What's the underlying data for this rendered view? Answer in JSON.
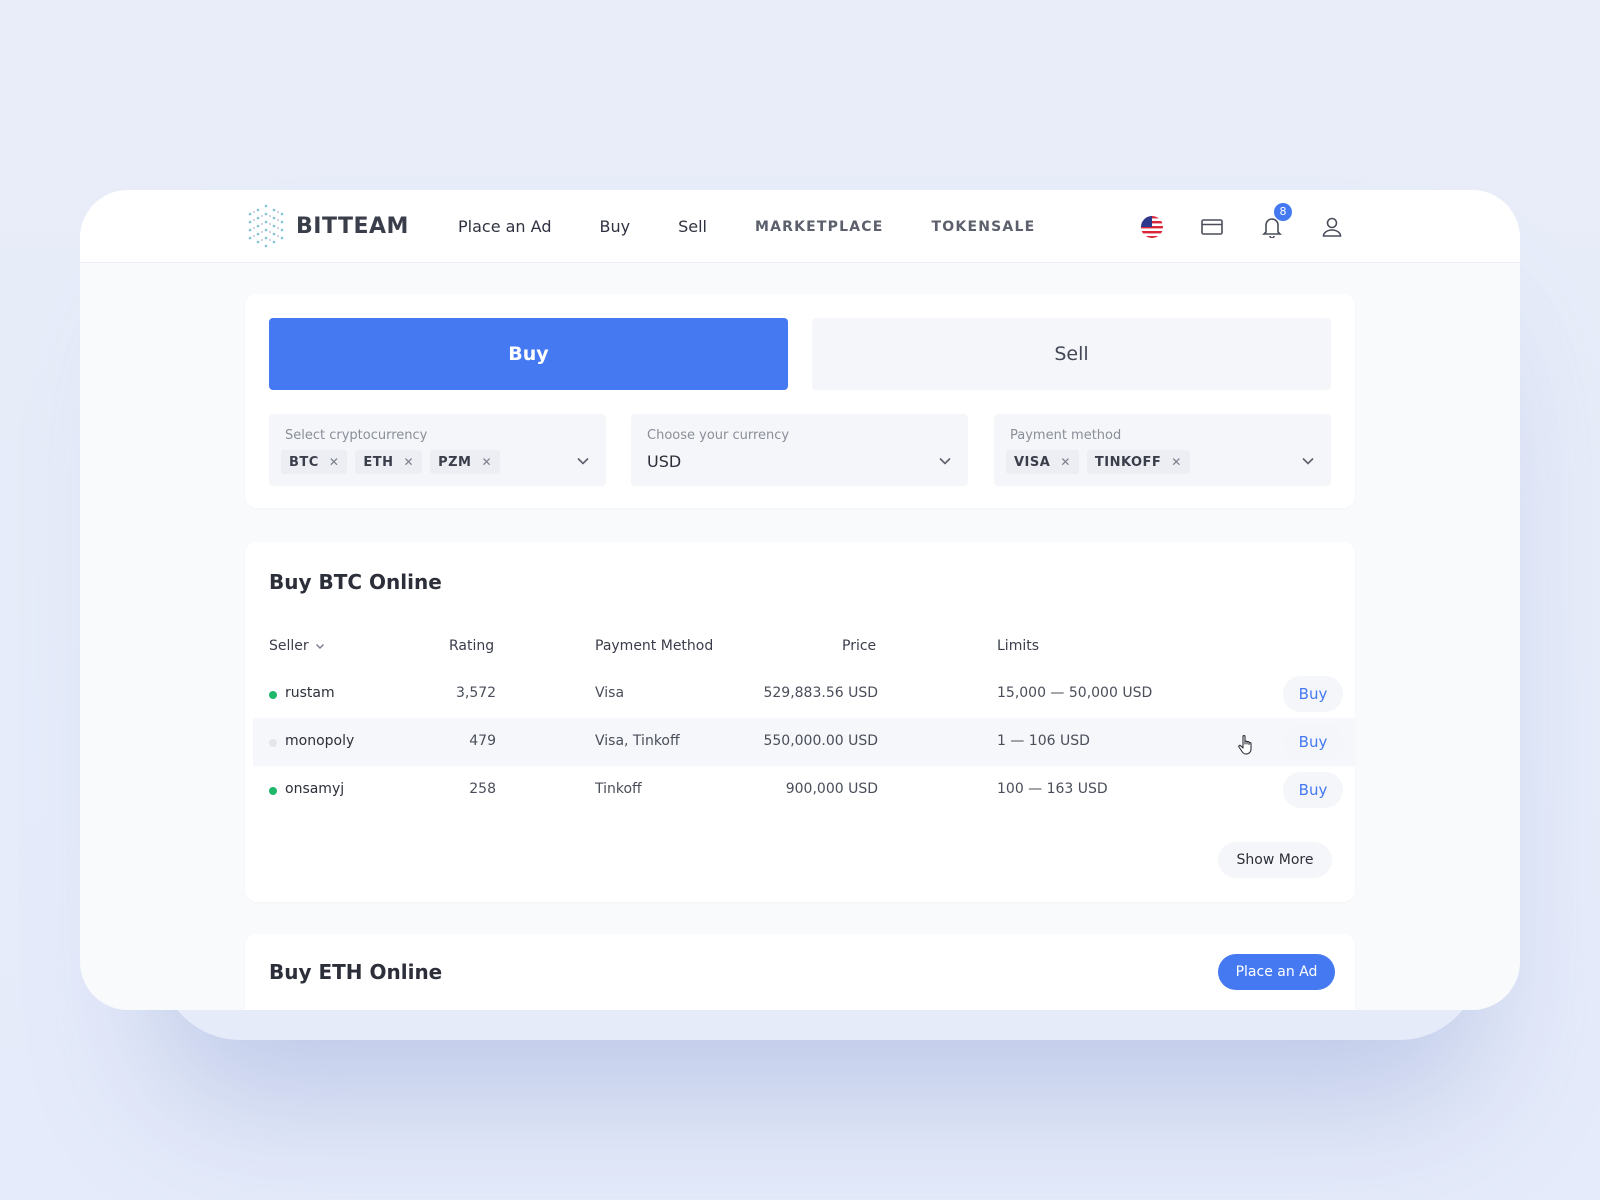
{
  "app": {
    "logo_text": "BITTEAM"
  },
  "nav": {
    "items": [
      {
        "label": "Place an Ad"
      },
      {
        "label": "Buy"
      },
      {
        "label": "Sell"
      },
      {
        "label": "MARKETPLACE"
      },
      {
        "label": "TOKENSALE"
      }
    ],
    "icons": [
      "us-flag-icon",
      "wallet-icon",
      "bell-icon",
      "user-icon"
    ],
    "notification_count": "8"
  },
  "filter": {
    "tabs": {
      "buy": "Buy",
      "sell": "Sell"
    },
    "crypto": {
      "label": "Select cryptocurrency",
      "chips": [
        "BTC",
        "ETH",
        "PZM"
      ]
    },
    "currency": {
      "label": "Choose your currency",
      "value": "USD"
    },
    "payment": {
      "label": "Payment method",
      "chips": [
        "VISA",
        "TINKOFF"
      ]
    }
  },
  "btc_section": {
    "title": "Buy BTC Online",
    "columns": {
      "seller": "Seller",
      "rating": "Rating",
      "payment": "Payment Method",
      "price": "Price",
      "limits": "Limits"
    },
    "rows": [
      {
        "seller": "rustam",
        "online": true,
        "rating": "3,572",
        "payment": "Visa",
        "price": "529,883.56 USD",
        "limits": "15,000 — 50,000 USD",
        "action": "Buy"
      },
      {
        "seller": "monopoly",
        "online": false,
        "rating": "479",
        "payment": "Visa, Tinkoff",
        "price": "550,000.00 USD",
        "limits": "1 — 106 USD",
        "action": "Buy"
      },
      {
        "seller": "onsamyj",
        "online": true,
        "rating": "258",
        "payment": "Tinkoff",
        "price": "900,000 USD",
        "limits": "100 — 163 USD",
        "action": "Buy"
      }
    ],
    "show_more": "Show More"
  },
  "eth_section": {
    "title": "Buy ETH Online",
    "place_ad": "Place an Ad"
  },
  "colors": {
    "accent": "#4479f2",
    "online": "#1fb86b",
    "offline": "#e4e6eb"
  }
}
